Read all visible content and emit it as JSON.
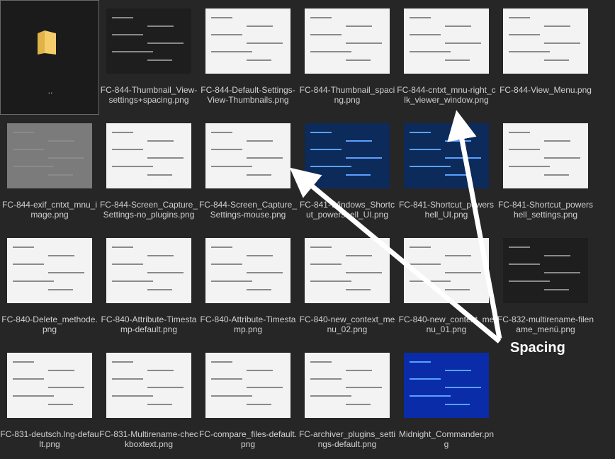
{
  "annotation": {
    "text": "Spacing"
  },
  "files": [
    {
      "name": "..",
      "type": "folder"
    },
    {
      "name": "FC-844-Thumbnail_View-settings+spacing.png",
      "style": "dark"
    },
    {
      "name": "FC-844-Default-Settings-View-Thumbnails.png",
      "style": "light"
    },
    {
      "name": "FC-844-Thumbnail_spacing.png",
      "style": "light"
    },
    {
      "name": "FC-844-cntxt_mnu-right_clk_viewer_window.png",
      "style": "light"
    },
    {
      "name": "FC-844-View_Menu.png",
      "style": "light"
    },
    {
      "name": "FC-844-exif_cntxt_mnu_image.png",
      "style": "gray"
    },
    {
      "name": "FC-844-Screen_Capture_Settings-no_plugins.png",
      "style": "light"
    },
    {
      "name": "FC-844-Screen_Capture_Settings-mouse.png",
      "style": "light"
    },
    {
      "name": "FC-841-Windows_Shortcut_powershell_UI.png",
      "style": "blue"
    },
    {
      "name": "FC-841-Shortcut_powershell_UI.png",
      "style": "blue"
    },
    {
      "name": "FC-841-Shortcut_powershell_settings.png",
      "style": "light"
    },
    {
      "name": "FC-840-Delete_methode.png",
      "style": "light"
    },
    {
      "name": "FC-840-Attribute-Timestamp-default.png",
      "style": "light"
    },
    {
      "name": "FC-840-Attribute-Timestamp.png",
      "style": "light"
    },
    {
      "name": "FC-840-new_context_menu_02.png",
      "style": "light"
    },
    {
      "name": "FC-840-new_context_menu_01.png",
      "style": "light"
    },
    {
      "name": "FC-832-multirename-filename_menü.png",
      "style": "dark"
    },
    {
      "name": "FC-831-deutsch.lng-default.png",
      "style": "light"
    },
    {
      "name": "FC-831-Multirename-checkboxtext.png",
      "style": "light"
    },
    {
      "name": "FC-compare_files-default.png",
      "style": "light"
    },
    {
      "name": "FC-archiver_plugins_settings-default.png",
      "style": "light"
    },
    {
      "name": "Midnight_Commander.png",
      "style": "mc"
    }
  ]
}
